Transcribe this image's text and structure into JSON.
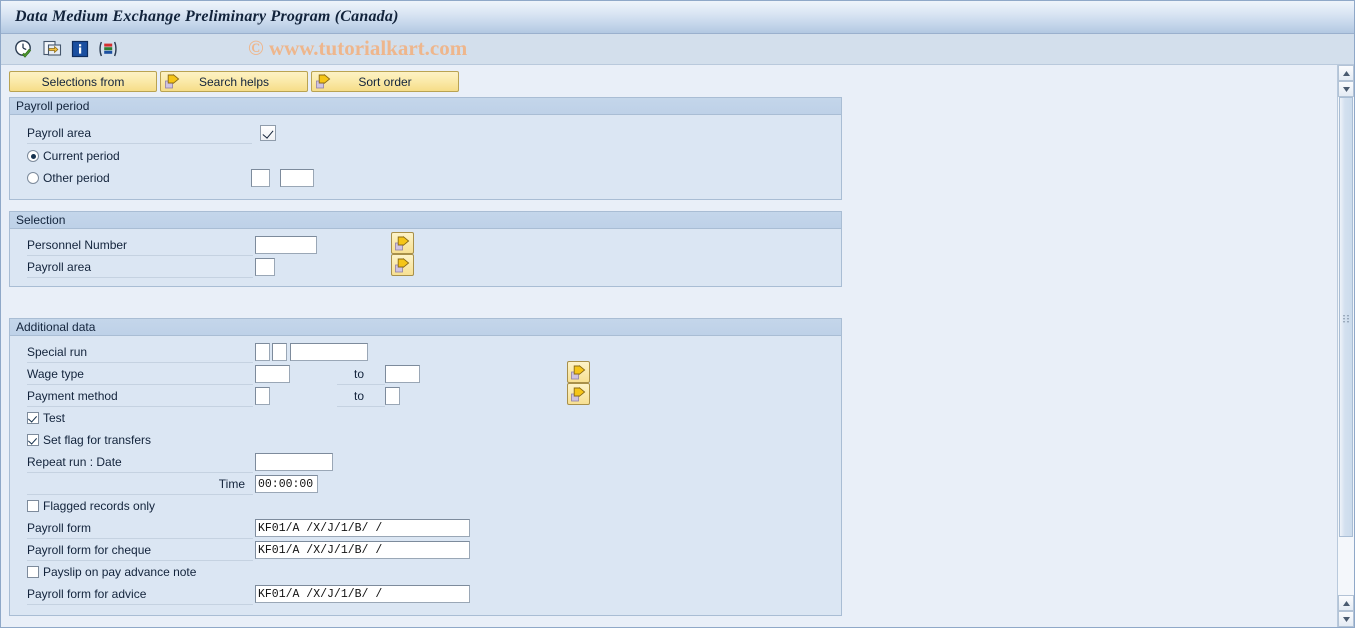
{
  "window": {
    "title": "Data Medium Exchange Preliminary Program (Canada)",
    "watermark": "© www.tutorialkart.com"
  },
  "toolbar": {
    "icons": [
      {
        "name": "execute-clock-check-icon",
        "title": "Execute"
      },
      {
        "name": "copy-variant-icon",
        "title": "Get variant"
      },
      {
        "name": "info-icon",
        "title": "Information"
      },
      {
        "name": "column-variant-icon",
        "title": "Layout"
      }
    ]
  },
  "buttons": {
    "selections_from": "Selections from",
    "search_helps": "Search helps",
    "sort_order": "Sort order"
  },
  "sections": {
    "payroll_period": {
      "title": "Payroll period",
      "payroll_area_label": "Payroll area",
      "payroll_area_value": "",
      "current_period_label": "Current period",
      "current_period_selected": true,
      "other_period_label": "Other period",
      "other_period_selected": false,
      "other_period_value_1": "",
      "other_period_value_2": ""
    },
    "selection": {
      "title": "Selection",
      "rows": [
        {
          "label": "Personnel Number",
          "value": ""
        },
        {
          "label": "Payroll area",
          "value": ""
        }
      ]
    },
    "additional_data": {
      "title": "Additional data",
      "special_run_label": "Special run",
      "special_run_value_1": "",
      "special_run_value_2": "",
      "special_run_value_3": "",
      "wage_type_label": "Wage type",
      "wage_type_from": "",
      "wage_type_to_label": "to",
      "wage_type_to": "",
      "payment_method_label": "Payment method",
      "payment_method_from": "",
      "payment_method_to_label": "to",
      "payment_method_to": "",
      "test_label": "Test",
      "test_checked": true,
      "set_flag_label": "Set flag for transfers",
      "set_flag_checked": true,
      "repeat_run_label": "Repeat run    : Date",
      "repeat_run_date": "",
      "time_label": "Time",
      "time_value": "00:00:00",
      "flagged_records_label": "Flagged records only",
      "flagged_records_checked": false,
      "payroll_form_label": "Payroll form",
      "payroll_form_value": "KF01/A /X/J/1/B/ /",
      "payroll_form_cheque_label": "Payroll form for cheque",
      "payroll_form_cheque_value": "KF01/A /X/J/1/B/ /",
      "payslip_advance_label": "Payslip on pay advance note",
      "payslip_advance_checked": false,
      "payroll_form_advice_label": "Payroll form for advice",
      "payroll_form_advice_value": "KF01/A /X/J/1/B/ /"
    }
  },
  "colors": {
    "title_bar": "#c3d5ea",
    "toolbar": "#d3dfec",
    "page_bg": "#e9eff8",
    "group_bg": "#dbe6f3",
    "group_header": "#c0d2e8",
    "button_yellow": "#fae9a8",
    "watermark": "#eeb68c"
  }
}
